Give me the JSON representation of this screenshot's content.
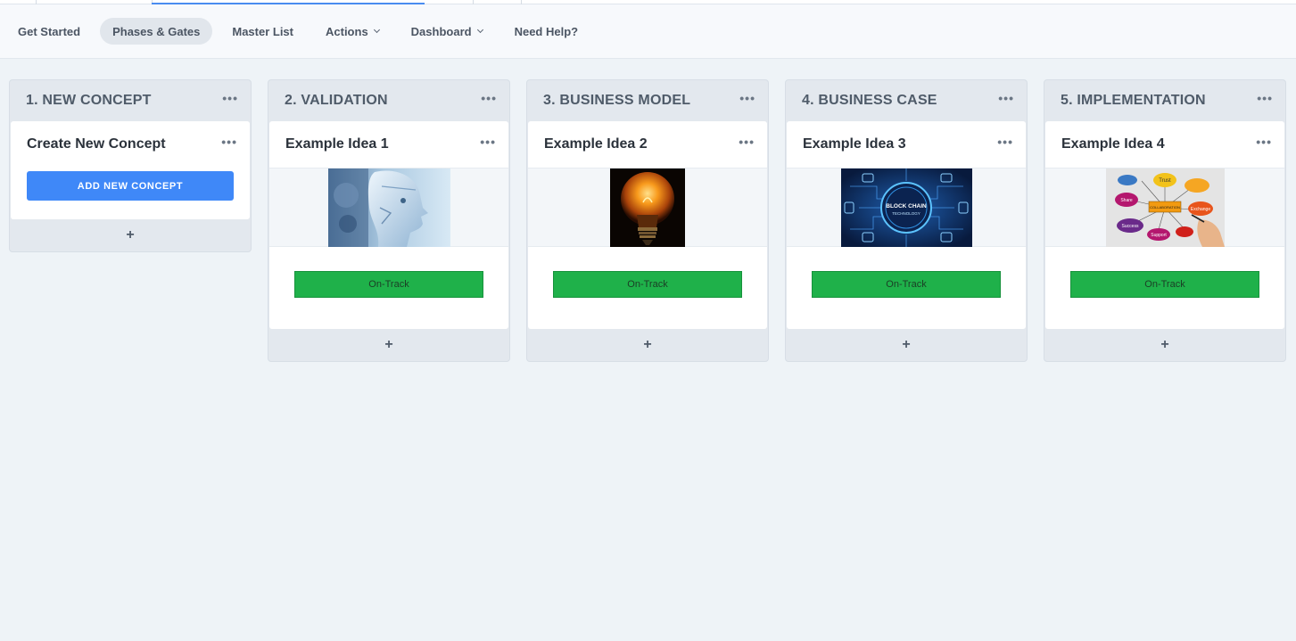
{
  "nav": {
    "items": [
      {
        "label": "Get Started"
      },
      {
        "label": "Phases & Gates",
        "active": true
      },
      {
        "label": "Master List"
      },
      {
        "label": "Actions",
        "has_dropdown": true
      },
      {
        "label": "Dashboard",
        "has_dropdown": true
      },
      {
        "label": "Need Help?"
      }
    ]
  },
  "columns": [
    {
      "title": "1. NEW CONCEPT",
      "menu": "•••",
      "card": {
        "title": "Create New Concept",
        "menu": "•••",
        "button_label": "ADD NEW CONCEPT"
      },
      "add_label": "+"
    },
    {
      "title": "2. VALIDATION",
      "menu": "•••",
      "card": {
        "title": "Example Idea 1",
        "menu": "•••",
        "image": "robot-face-image",
        "status": "On-Track"
      },
      "add_label": "+"
    },
    {
      "title": "3. BUSINESS MODEL",
      "menu": "•••",
      "card": {
        "title": "Example Idea 2",
        "menu": "•••",
        "image": "light-bulb-image",
        "status": "On-Track"
      },
      "add_label": "+"
    },
    {
      "title": "4. BUSINESS CASE",
      "menu": "•••",
      "card": {
        "title": "Example Idea 3",
        "menu": "•••",
        "image": "blockchain-image",
        "image_text": [
          "BLOCK CHAIN",
          "TECHNOLOGY"
        ],
        "status": "On-Track"
      },
      "add_label": "+"
    },
    {
      "title": "5. IMPLEMENTATION",
      "menu": "•••",
      "card": {
        "title": "Example Idea 4",
        "menu": "•••",
        "image": "collaboration-mindmap-image",
        "image_text": [
          "Trust",
          "Share",
          "Success",
          "Support",
          "Exchange",
          "COLLABORATION"
        ],
        "status": "On-Track"
      },
      "add_label": "+"
    }
  ],
  "colors": {
    "accent": "#3f88f8",
    "status_on_track": "#1fb14a",
    "background": "#eef3f7"
  }
}
